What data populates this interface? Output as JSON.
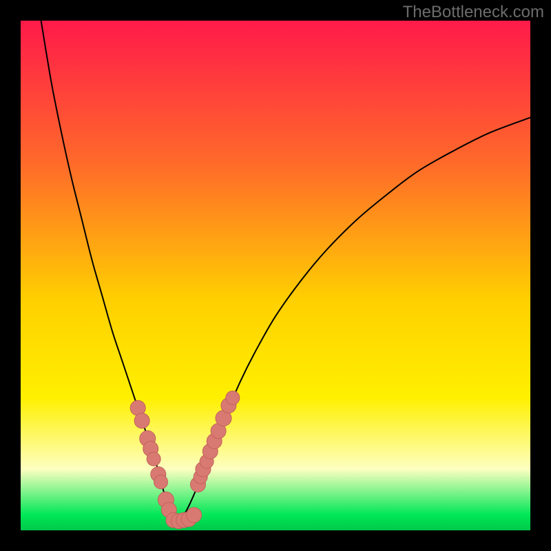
{
  "watermark": "TheBottleneck.com",
  "colors": {
    "frame": "#000000",
    "gradient_top": "#ff1a4a",
    "gradient_mid_upper": "#ff6a2a",
    "gradient_mid": "#ffd000",
    "gradient_yellow": "#fff000",
    "gradient_pale": "#fdffc0",
    "gradient_green": "#00e756",
    "curve": "#000000",
    "marker_fill": "#d97a72",
    "marker_stroke": "#c2625a"
  },
  "chart_data": {
    "type": "line",
    "title": "",
    "xlabel": "",
    "ylabel": "",
    "xlim": [
      0,
      100
    ],
    "ylim": [
      0,
      100
    ],
    "series": [
      {
        "name": "bottleneck-curve-left",
        "x": [
          4,
          6,
          8,
          10,
          12,
          14,
          16,
          18,
          20,
          22,
          24,
          26,
          27.2,
          28.5,
          30
        ],
        "y": [
          100,
          88,
          78,
          69,
          61,
          53,
          46,
          39,
          33,
          27,
          21,
          15,
          11,
          6,
          1.5
        ]
      },
      {
        "name": "bottleneck-curve-right",
        "x": [
          30,
          32,
          34,
          36,
          38,
          40,
          43,
          46,
          50,
          55,
          60,
          66,
          72,
          78,
          85,
          92,
          100
        ],
        "y": [
          1.5,
          3,
          7,
          12,
          17,
          22,
          29,
          35,
          42,
          49,
          55,
          61,
          66,
          70.5,
          74.5,
          78,
          81
        ]
      }
    ],
    "markers": [
      {
        "x": 23.0,
        "y": 24.0,
        "r": 2.0
      },
      {
        "x": 23.8,
        "y": 21.5,
        "r": 2.0
      },
      {
        "x": 24.9,
        "y": 18.0,
        "r": 2.2
      },
      {
        "x": 25.5,
        "y": 16.0,
        "r": 2.0
      },
      {
        "x": 26.1,
        "y": 14.0,
        "r": 1.6
      },
      {
        "x": 27.0,
        "y": 11.0,
        "r": 2.0
      },
      {
        "x": 27.5,
        "y": 9.5,
        "r": 1.6
      },
      {
        "x": 28.5,
        "y": 6.0,
        "r": 2.2
      },
      {
        "x": 29.1,
        "y": 4.0,
        "r": 2.0
      },
      {
        "x": 30.0,
        "y": 2.0,
        "r": 2.0
      },
      {
        "x": 31.0,
        "y": 1.8,
        "r": 2.0
      },
      {
        "x": 32.0,
        "y": 2.0,
        "r": 2.0
      },
      {
        "x": 33.0,
        "y": 2.2,
        "r": 2.0
      },
      {
        "x": 34.0,
        "y": 3.0,
        "r": 2.0
      },
      {
        "x": 34.8,
        "y": 9.0,
        "r": 2.0
      },
      {
        "x": 35.3,
        "y": 10.5,
        "r": 1.6
      },
      {
        "x": 35.8,
        "y": 12.0,
        "r": 2.0
      },
      {
        "x": 36.5,
        "y": 13.5,
        "r": 1.6
      },
      {
        "x": 37.2,
        "y": 15.5,
        "r": 2.0
      },
      {
        "x": 38.0,
        "y": 17.5,
        "r": 2.0
      },
      {
        "x": 38.8,
        "y": 19.5,
        "r": 2.0
      },
      {
        "x": 39.8,
        "y": 22.0,
        "r": 2.2
      },
      {
        "x": 40.8,
        "y": 24.5,
        "r": 2.0
      },
      {
        "x": 41.6,
        "y": 26.0,
        "r": 1.6
      }
    ]
  }
}
